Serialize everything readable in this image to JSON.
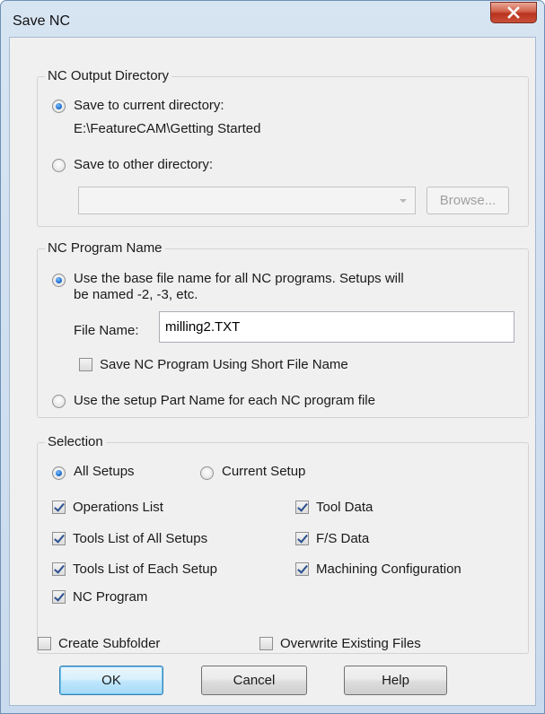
{
  "window": {
    "title": "Save NC",
    "close_icon": "close-icon"
  },
  "output_directory": {
    "group_label": "NC Output Directory",
    "save_current_label": "Save to current directory:",
    "current_path": "E:\\FeatureCAM\\Getting Started",
    "save_other_label": "Save to other directory:",
    "other_directory_value": "",
    "browse_label": "Browse...",
    "save_current_selected": true
  },
  "program_name": {
    "group_label": "NC Program Name",
    "use_base_line1": "Use the base file name for all NC programs.  Setups will",
    "use_base_line2": "be named -2, -3, etc.",
    "file_name_label": "File Name:",
    "file_name_value": "milling2.TXT",
    "short_name_label": "Save NC Program Using Short File Name",
    "short_name_checked": false,
    "use_part_name_label": "Use the setup Part Name for each NC program file",
    "use_base_selected": true
  },
  "selection": {
    "group_label": "Selection",
    "all_setups_label": "All Setups",
    "current_setup_label": "Current Setup",
    "all_setups_selected": true,
    "options": {
      "operations_list": "Operations List",
      "tools_all_setups": "Tools List of All Setups",
      "tools_each_setup": "Tools List of Each Setup",
      "nc_program": "NC Program",
      "tool_data": "Tool Data",
      "fs_data": "F/S Data",
      "machining_config": "Machining Configuration"
    }
  },
  "bottom": {
    "create_subfolder_label": "Create Subfolder",
    "overwrite_label": "Overwrite Existing Files",
    "create_subfolder_checked": false,
    "overwrite_checked": false
  },
  "buttons": {
    "ok": "OK",
    "cancel": "Cancel",
    "help": "Help"
  },
  "colors": {
    "dialog_bg": "#f0f0f0",
    "frame": "#c9daee",
    "close_button": "#c9503a",
    "default_button": "#bee6fd"
  }
}
